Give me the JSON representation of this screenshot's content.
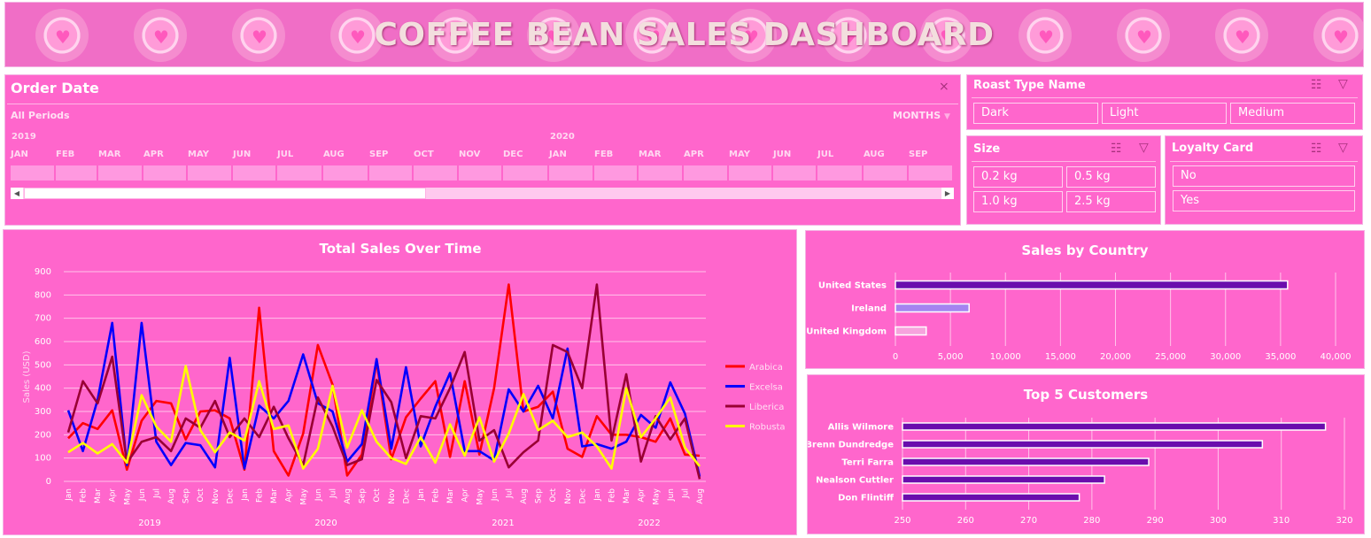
{
  "header": {
    "title": "COFFEE BEAN SALES DASHBOARD"
  },
  "timeline": {
    "title": "Order Date",
    "period_label": "All Periods",
    "unit_label": "MONTHS",
    "years": [
      "2019",
      "2020"
    ],
    "months": [
      "JAN",
      "FEB",
      "MAR",
      "APR",
      "MAY",
      "JUN",
      "JUL",
      "AUG",
      "SEP",
      "OCT",
      "NOV",
      "DEC",
      "JAN",
      "FEB",
      "MAR",
      "APR",
      "MAY",
      "JUN",
      "JUL",
      "AUG",
      "SEP"
    ]
  },
  "slicers": {
    "roast": {
      "title": "Roast Type Name",
      "items": [
        "Dark",
        "Light",
        "Medium"
      ]
    },
    "size": {
      "title": "Size",
      "items": [
        "0.2 kg",
        "0.5 kg",
        "1.0 kg",
        "2.5 kg"
      ]
    },
    "loyalty": {
      "title": "Loyalty Card",
      "items": [
        "No",
        "Yes"
      ]
    }
  },
  "colors": {
    "panel": "#ff66cc",
    "arabica": "#ff0000",
    "excelsa": "#0000ff",
    "liberica": "#990033",
    "robusta": "#ffff00",
    "bar_dark": "#6a0dad"
  },
  "chart_data": [
    {
      "type": "line",
      "title": "Total Sales Over Time",
      "ylabel": "Sales (USD)",
      "ylim": [
        0,
        900
      ],
      "yticks": [
        0,
        100,
        200,
        300,
        400,
        500,
        600,
        700,
        800,
        900
      ],
      "x": [
        "Jan",
        "Feb",
        "Mar",
        "Apr",
        "May",
        "Jun",
        "Jul",
        "Aug",
        "Sep",
        "Oct",
        "Nov",
        "Dec",
        "Jan",
        "Feb",
        "Mar",
        "Apr",
        "May",
        "Jun",
        "Jul",
        "Aug",
        "Sep",
        "Oct",
        "Nov",
        "Dec",
        "Jan",
        "Feb",
        "Mar",
        "Apr",
        "May",
        "Jun",
        "Jul",
        "Aug",
        "Sep",
        "Oct",
        "Nov",
        "Dec",
        "Jan",
        "Feb",
        "Mar",
        "Apr",
        "May",
        "Jun",
        "Jul",
        "Aug"
      ],
      "year_labels": [
        "2019",
        "2020",
        "2021",
        "2022"
      ],
      "grid": true,
      "legend": "right",
      "series": [
        {
          "name": "Arabica",
          "values": [
            185,
            250,
            225,
            305,
            50,
            260,
            345,
            335,
            180,
            300,
            305,
            270,
            50,
            745,
            130,
            25,
            205,
            585,
            415,
            25,
            115,
            515,
            95,
            275,
            355,
            430,
            105,
            430,
            115,
            400,
            845,
            300,
            320,
            385,
            140,
            105,
            280,
            200,
            200,
            190,
            170,
            270,
            115,
            110
          ]
        },
        {
          "name": "Excelsa",
          "values": [
            305,
            130,
            350,
            680,
            70,
            680,
            170,
            70,
            165,
            155,
            60,
            530,
            55,
            325,
            270,
            345,
            545,
            335,
            300,
            85,
            160,
            525,
            140,
            490,
            150,
            320,
            465,
            130,
            130,
            90,
            395,
            300,
            410,
            270,
            570,
            150,
            160,
            140,
            170,
            285,
            230,
            425,
            290,
            20
          ]
        },
        {
          "name": "Liberica",
          "values": [
            210,
            430,
            335,
            535,
            80,
            170,
            190,
            130,
            270,
            230,
            345,
            190,
            270,
            190,
            320,
            185,
            70,
            360,
            235,
            70,
            95,
            435,
            340,
            100,
            280,
            270,
            400,
            555,
            175,
            220,
            60,
            125,
            175,
            585,
            555,
            400,
            845,
            175,
            460,
            85,
            280,
            180,
            270,
            10
          ]
        },
        {
          "name": "Robusta",
          "values": [
            125,
            165,
            120,
            160,
            80,
            370,
            235,
            170,
            495,
            220,
            125,
            210,
            175,
            430,
            225,
            240,
            55,
            140,
            410,
            145,
            305,
            170,
            100,
            75,
            190,
            80,
            245,
            110,
            275,
            85,
            205,
            375,
            220,
            260,
            190,
            210,
            150,
            55,
            400,
            190,
            270,
            360,
            145,
            65
          ]
        }
      ]
    },
    {
      "type": "bar",
      "title": "Sales by Country",
      "categories": [
        "United States",
        "Ireland",
        "United Kingdom"
      ],
      "values": [
        35639,
        6697,
        2799
      ],
      "bar_colors": [
        "#6a0dad",
        "#a583f0",
        "#f7a3dd"
      ],
      "xlim": [
        0,
        40000
      ],
      "xticks": [
        "0",
        "5,000",
        "10,000",
        "15,000",
        "20,000",
        "25,000",
        "30,000",
        "35,000",
        "40,000"
      ],
      "grid": true
    },
    {
      "type": "bar",
      "title": "Top 5 Customers",
      "categories": [
        "Allis Wilmore",
        "Brenn Dundredge",
        "Terri Farra",
        "Nealson Cuttler",
        "Don Flintiff"
      ],
      "values": [
        317,
        307,
        289,
        282,
        278
      ],
      "xlim": [
        250,
        320
      ],
      "xticks": [
        "250",
        "260",
        "270",
        "280",
        "290",
        "300",
        "310",
        "320"
      ],
      "grid": true
    }
  ]
}
